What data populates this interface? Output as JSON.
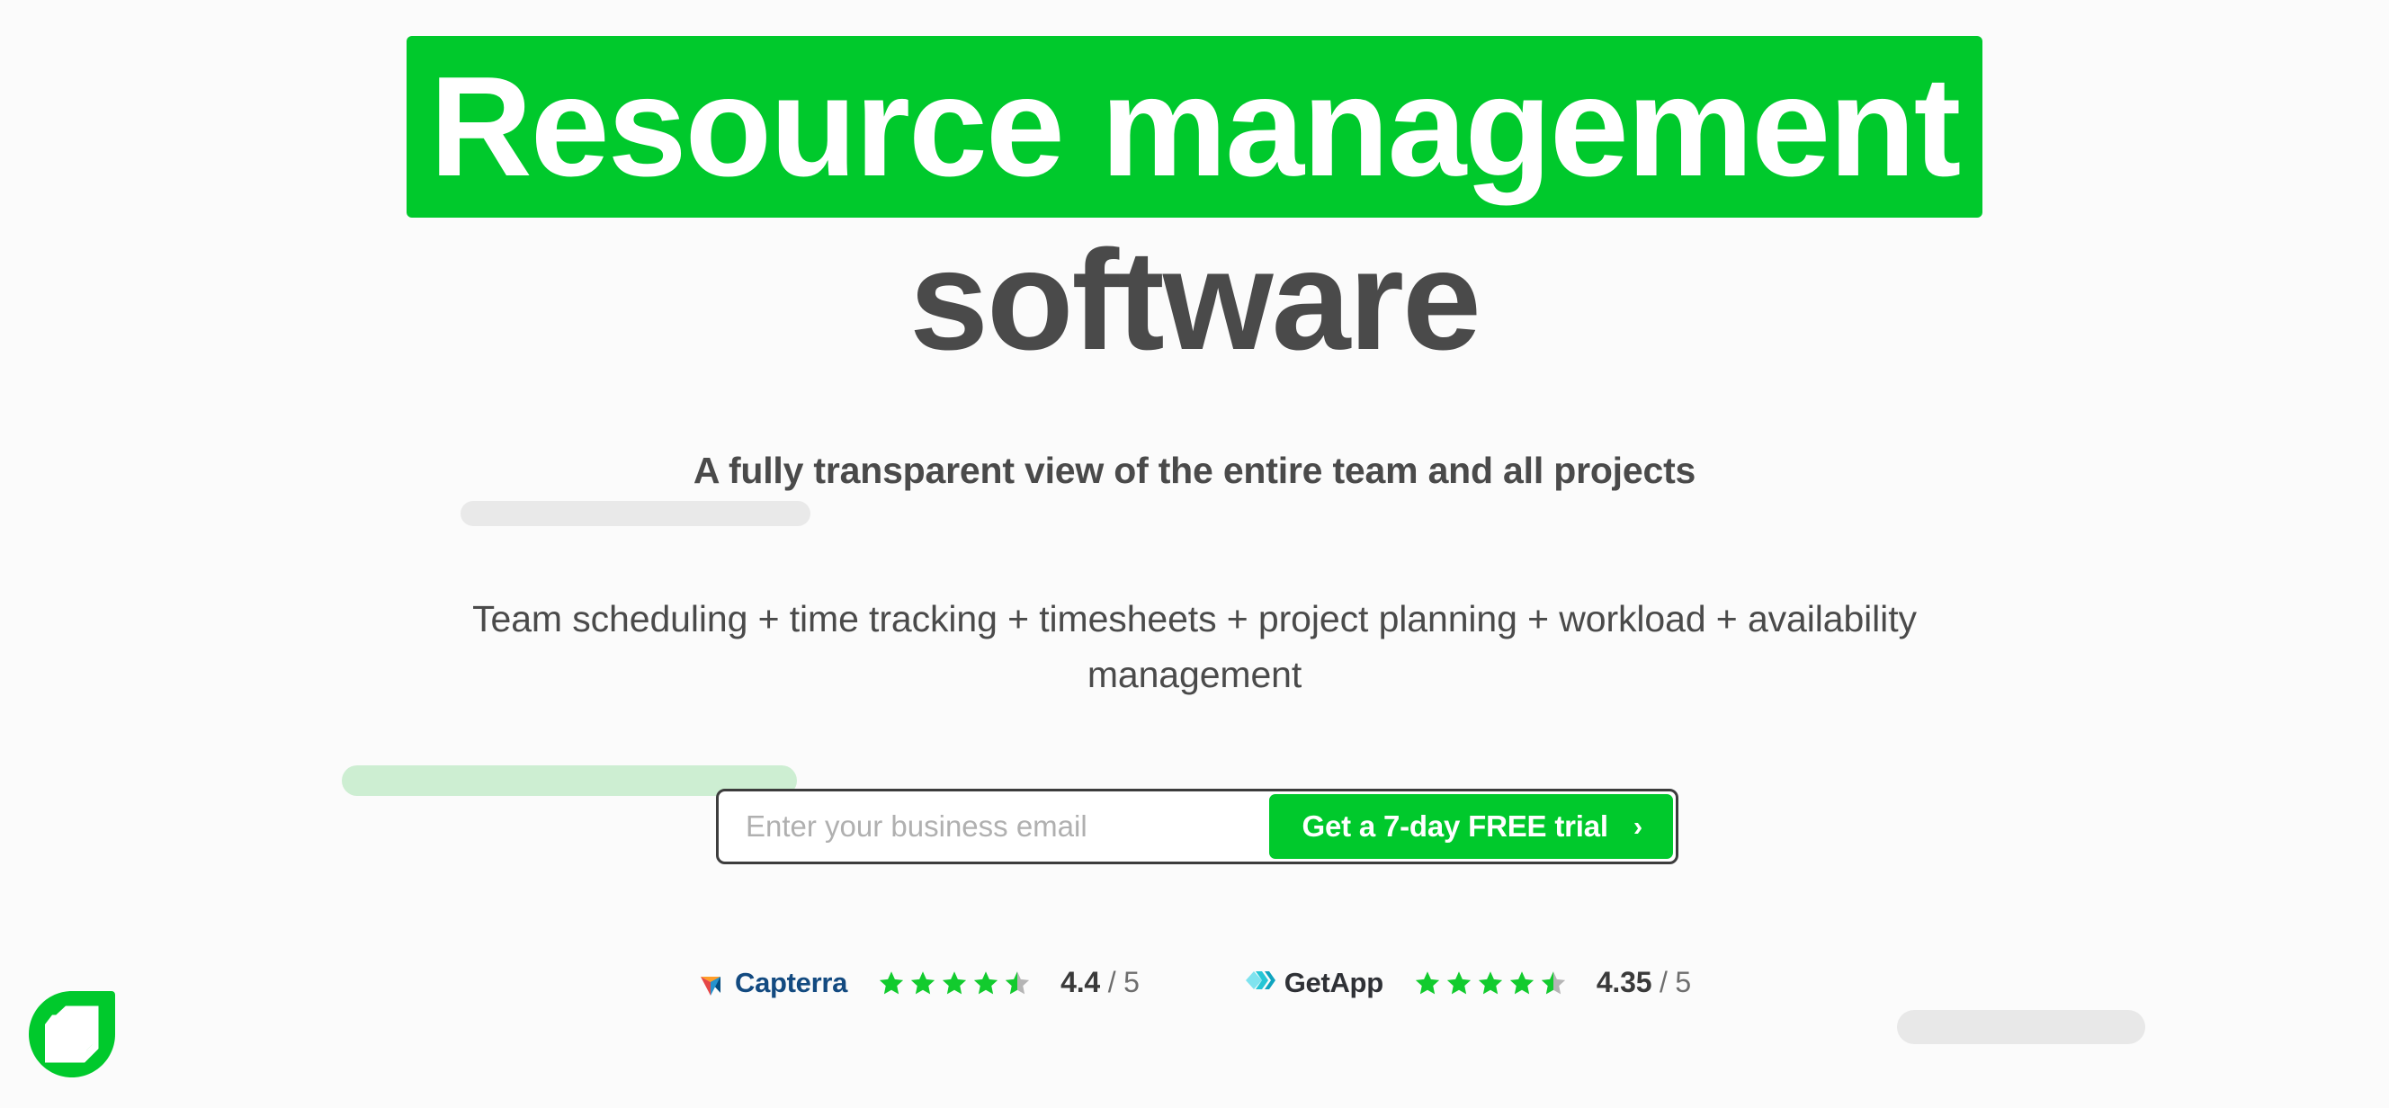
{
  "theme": {
    "background": "#fbfbfb",
    "accent_green": "#00c92c",
    "text_dark": "#4a4a4a",
    "highlight_green_pale": "#cdeed2",
    "skeleton_gray": "#e8e8e8",
    "star_green": "#12cb2e",
    "star_gray": "#b5b5b5"
  },
  "hero": {
    "headline_line1": "Resource management",
    "headline_line2": "software",
    "subheading": "A fully transparent view of the entire team and all projects",
    "body_line1": "Team scheduling + time tracking + timesheets + project planning + workload + availability",
    "body_line2": "management"
  },
  "signup": {
    "email_placeholder": "Enter your business email",
    "email_value": "",
    "cta_label": "Get a 7-day FREE trial",
    "cta_chevron": "›"
  },
  "ratings": [
    {
      "brand": "Capterra",
      "icon": "capterra-logo-icon",
      "score": "4.4",
      "max": "/ 5",
      "stars_full": 4,
      "stars_half": 1,
      "stars_total": 5
    },
    {
      "brand": "GetApp",
      "icon": "getapp-logo-icon",
      "score": "4.35",
      "max": "/ 5",
      "stars_full": 4,
      "stars_half": 1,
      "stars_total": 5
    }
  ],
  "corner": {
    "logo_icon": "teamdeck-droplet-logo-icon"
  }
}
